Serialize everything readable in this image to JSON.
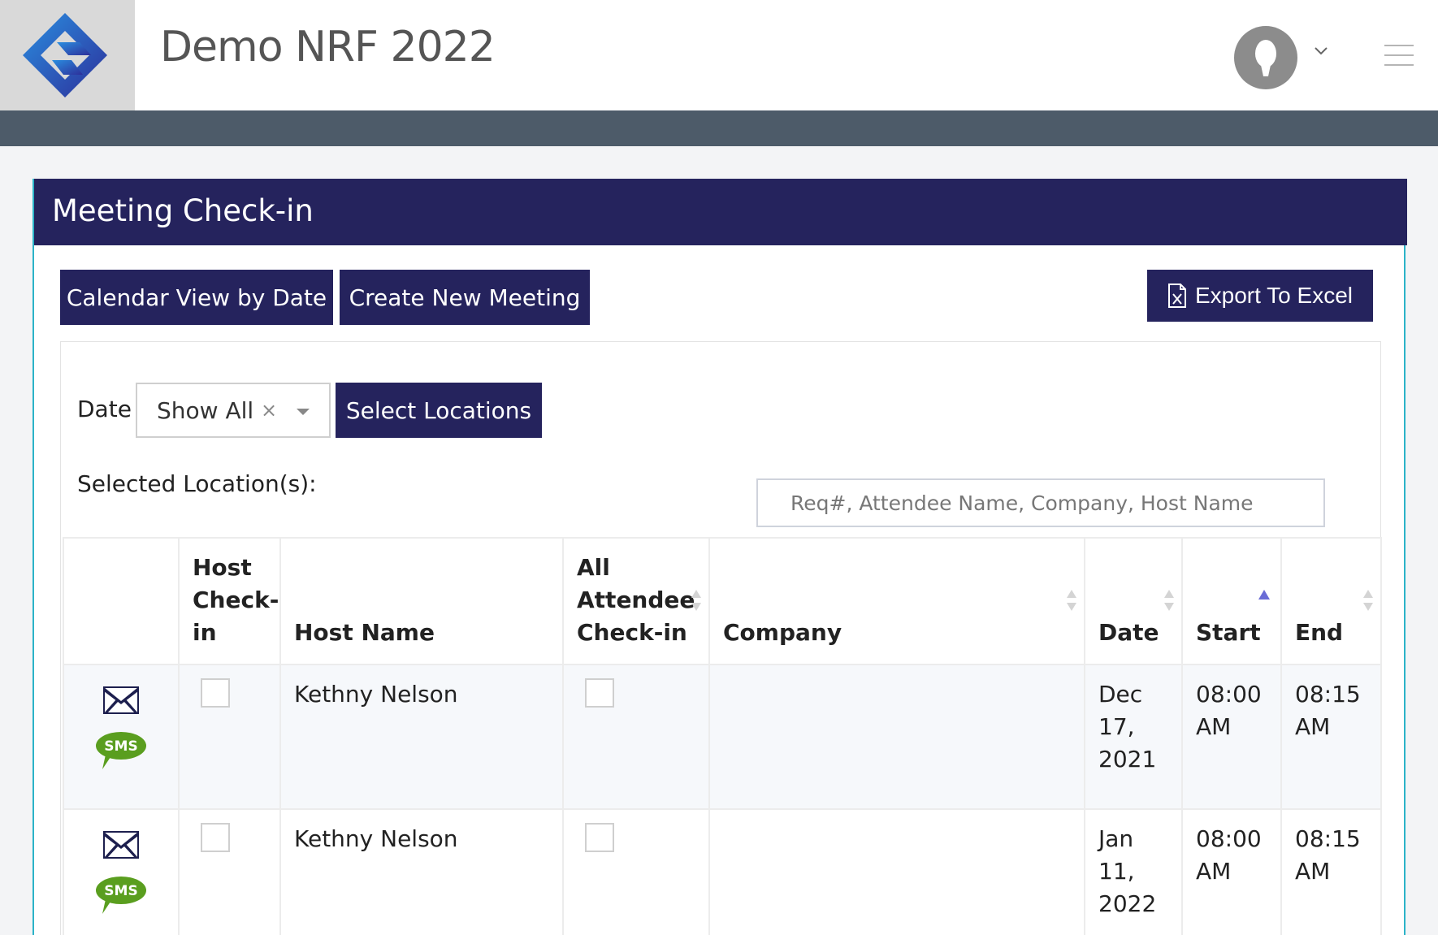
{
  "header": {
    "app_title": "Demo NRF 2022"
  },
  "panel": {
    "title": "Meeting Check-in"
  },
  "toolbar": {
    "calendar_label": "Calendar View by Date",
    "create_label": "Create New Meeting",
    "export_label": "Export To Excel"
  },
  "filters": {
    "date_label": "Date",
    "date_value": "Show All",
    "clear_symbol": "×",
    "locations_button": "Select Locations",
    "selected_locations_label": "Selected Location(s):",
    "search_placeholder": "Req#, Attendee Name, Company, Host Name"
  },
  "table": {
    "columns": {
      "host_checkin": "Host Check-in",
      "host_name": "Host Name",
      "attendee_checkin": "All Attendee Check-in",
      "company": "Company",
      "date": "Date",
      "start": "Start",
      "end": "End"
    },
    "rows": [
      {
        "sms": "SMS",
        "host_name": "Kethny Nelson",
        "company": "",
        "date": "Dec 17, 2021",
        "start": "08:00 AM",
        "end": "08:15 AM"
      },
      {
        "sms": "SMS",
        "host_name": "Kethny Nelson",
        "company": "",
        "date": "Jan 11, 2022",
        "start": "08:00 AM",
        "end": "08:15 AM"
      }
    ]
  },
  "colors": {
    "brand_navy": "#25235d",
    "nav_slate": "#4d5b69",
    "panel_border": "#2bb3c8",
    "sms_green": "#5a9e1f"
  },
  "icons": [
    "logo-icon",
    "user-avatar-icon",
    "chevron-down-icon",
    "hamburger-menu-icon",
    "excel-file-icon",
    "email-icon",
    "sms-icon",
    "sort-icon",
    "sort-ascending-icon"
  ]
}
